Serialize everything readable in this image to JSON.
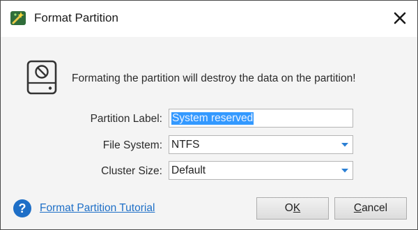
{
  "window": {
    "title": "Format Partition",
    "app_icon": "wand-icon",
    "close_icon": "close-icon"
  },
  "warning": {
    "icon": "disk-forbidden-icon",
    "text": "Formating the partition will destroy the data on the partition!"
  },
  "form": {
    "partition_label": {
      "label": "Partition Label:",
      "value": "System reserved",
      "selected": true
    },
    "file_system": {
      "label": "File System:",
      "value": "NTFS"
    },
    "cluster_size": {
      "label": "Cluster Size:",
      "value": "Default"
    }
  },
  "footer": {
    "help_icon": "help-icon",
    "tutorial_link": "Format Partition Tutorial",
    "ok_prefix": "O",
    "ok_underlined": "K",
    "ok_suffix": "",
    "cancel_underlined": "C",
    "cancel_suffix": "ancel"
  },
  "colors": {
    "accent": "#1e6fc7",
    "selection": "#3399ff",
    "dropdown_arrow": "#2a7fd4"
  }
}
